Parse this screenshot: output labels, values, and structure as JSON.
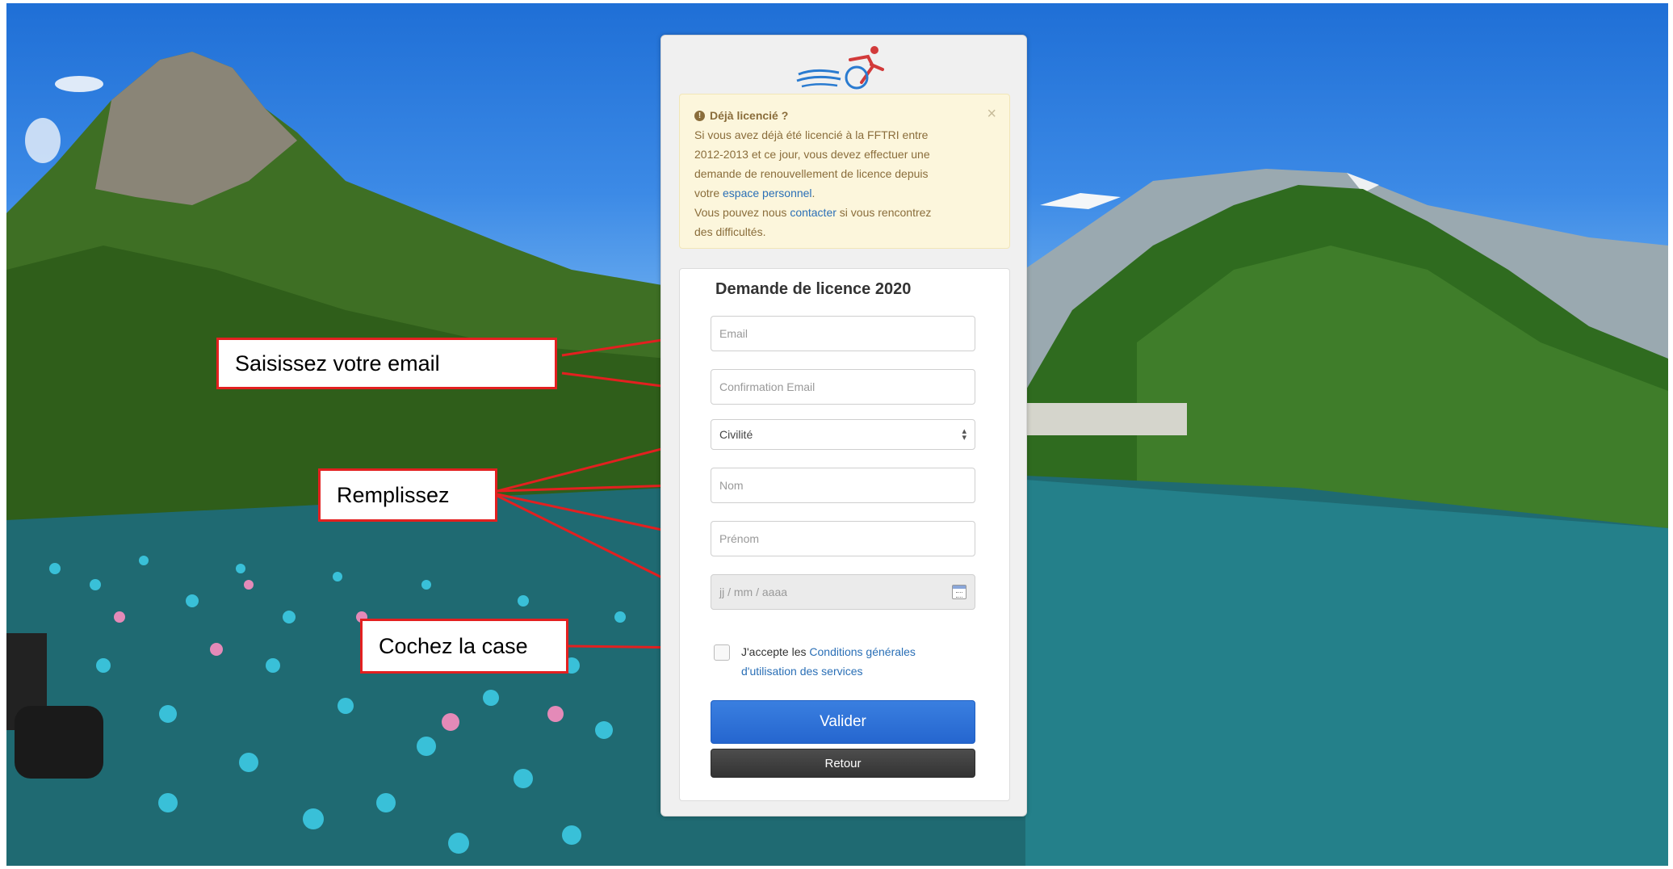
{
  "alert": {
    "title": "Déjà licencié ?",
    "line1": "Si vous avez déjà été licencié à la FFTRI entre",
    "line2": "2012-2013 et ce jour, vous devez effectuer une",
    "line3": "demande de renouvellement de licence depuis",
    "line4_prefix": "votre",
    "link_personal_space": "espace personnel",
    "line4_suffix": ".",
    "line5_prefix": "Vous pouvez nous",
    "link_contact": "contacter",
    "line5_suffix": "si vous rencontrez",
    "line6": "des difficultés.",
    "close": "×"
  },
  "form": {
    "title": "Demande de licence 2020",
    "email_placeholder": "Email",
    "email_confirm_placeholder": "Confirmation Email",
    "civility_value": "Civilité",
    "lastname_placeholder": "Nom",
    "firstname_placeholder": "Prénom",
    "birthdate_placeholder": "jj / mm / aaaa",
    "terms_prefix": "J'accepte les",
    "terms_link": "Conditions générales d'utilisation des services",
    "submit_label": "Valider",
    "back_label": "Retour"
  },
  "callouts": {
    "email": "Saisissez votre email",
    "fill": "Remplissez",
    "check": "Cochez la case"
  },
  "colors": {
    "callout_border": "#e32020",
    "submit": "#2b6fd6",
    "back": "#404040",
    "link": "#2a6fb6"
  }
}
